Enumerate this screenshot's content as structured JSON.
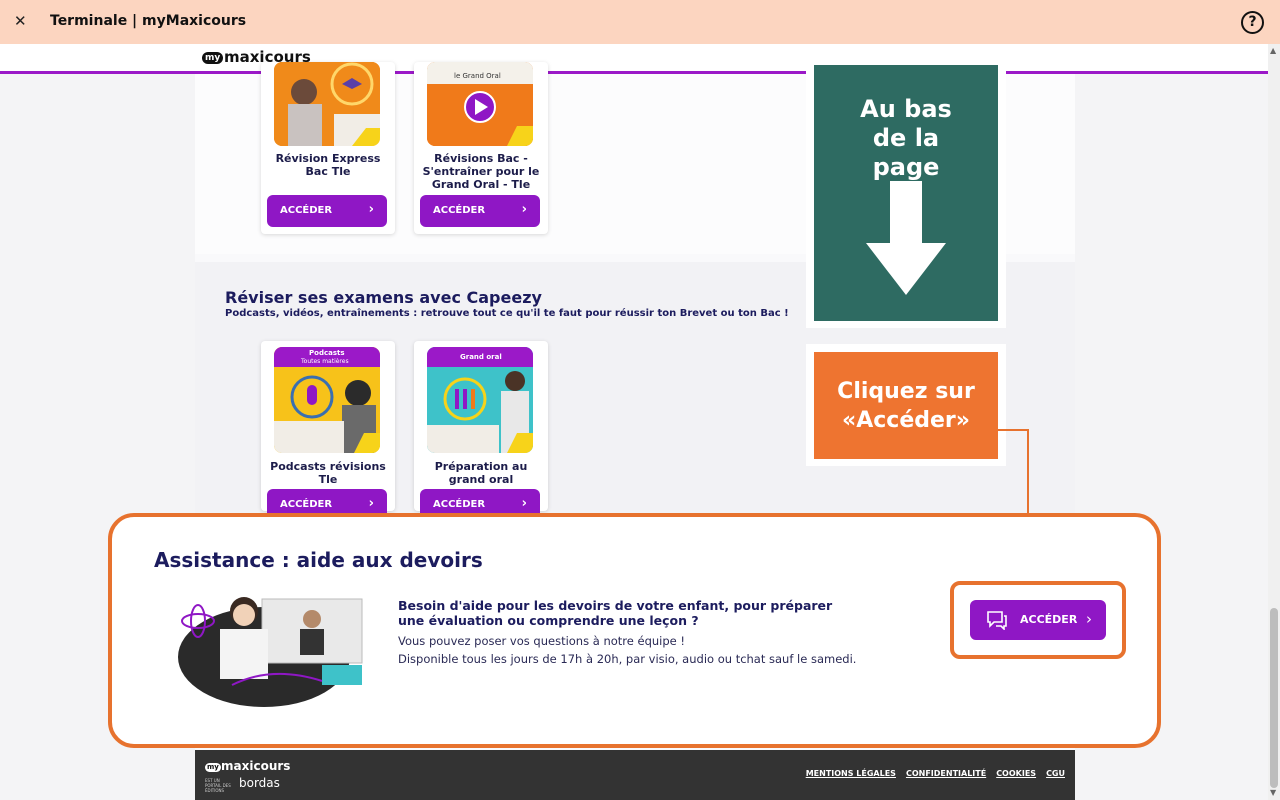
{
  "window": {
    "title": "Terminale | myMaxicours",
    "close_icon": "close-icon",
    "help_icon": "question-icon",
    "help_glyph": "?"
  },
  "brand": {
    "my": "my",
    "name": "maxicours"
  },
  "cards_top": [
    {
      "title": "Révision Express Bac Tle",
      "button": "ACCÉDER",
      "thumb_color": "#f08a1a"
    },
    {
      "title": "Révisions Bac - S'entraîner pour le Grand Oral - Tle",
      "button": "ACCÉDER",
      "thumb_color": "#f07a1a",
      "thumb_caption": "le Grand Oral"
    }
  ],
  "section2": {
    "title": "Réviser ses examens avec Capeezy",
    "subtitle": "Podcasts, vidéos, entraînements : retrouve tout ce qu'il te faut pour réussir ton Brevet ou ton Bac !",
    "cards": [
      {
        "title": "Podcasts révisions Tle",
        "button": "ACCÉDER",
        "badge": "Podcasts",
        "badge_sub": "Toutes matières"
      },
      {
        "title": "Préparation au grand oral",
        "button": "ACCÉDER",
        "badge": "Grand oral"
      }
    ]
  },
  "callouts": {
    "green": "Au bas de la page",
    "orange": "Cliquez sur «Accéder»"
  },
  "assistance": {
    "title": "Assistance : aide aux devoirs",
    "headline": "Besoin d'aide pour les devoirs de votre enfant, pour préparer une évaluation ou comprendre une leçon ?",
    "line1": "Vous pouvez poser vos questions à notre équipe !",
    "line2": "Disponible tous les jours de 17h à 20h, par visio, audio ou tchat sauf le samedi.",
    "button": "ACCÉDER"
  },
  "footer": {
    "brand": "maxicours",
    "my": "my",
    "sub": "EST UN PORTAIL DES ÉDITIONS",
    "publisher": "bordas",
    "links": [
      "MENTIONS LÉGALES",
      "CONFIDENTIALITÉ",
      "COOKIES",
      "CGU"
    ]
  },
  "colors": {
    "accent": "#8f17c5",
    "highlight": "#e7722e",
    "callout_green": "#2e6b62",
    "topbar": "#fcd5c0"
  }
}
